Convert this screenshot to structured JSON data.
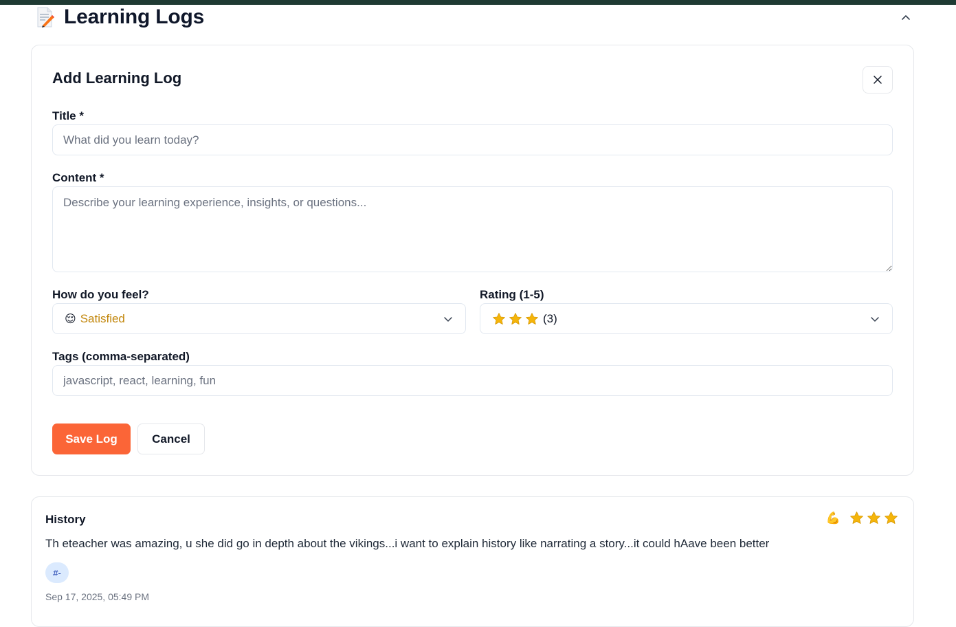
{
  "header": {
    "title": "Learning Logs",
    "icon": "memo-icon"
  },
  "form": {
    "title": "Add Learning Log",
    "title_label": "Title *",
    "title_placeholder": "What did you learn today?",
    "content_label": "Content *",
    "content_placeholder": "Describe your learning experience, insights, or questions...",
    "mood_label": "How do you feel?",
    "mood_emoji": "😌",
    "mood_value": "Satisfied",
    "rating_label": "Rating (1-5)",
    "rating_value": 3,
    "rating_text": "(3)",
    "tags_label": "Tags (comma-separated)",
    "tags_placeholder": "javascript, react, learning, fun",
    "save_label": "Save Log",
    "cancel_label": "Cancel"
  },
  "logs": [
    {
      "title": "History",
      "mood_emoji": "💪",
      "rating": 3,
      "content": "Th eteacher was amazing, u she did go in depth about the vikings...i want to explain history like narrating a story...it could hAave been better",
      "tags": [
        "#-"
      ],
      "date": "Sep 17, 2025, 05:49 PM"
    }
  ],
  "colors": {
    "accent": "#fb6537",
    "mood_text": "#c2860a",
    "star": "#f5b50a",
    "tag_bg": "#dbeafe",
    "topbar": "#1f3a33"
  }
}
